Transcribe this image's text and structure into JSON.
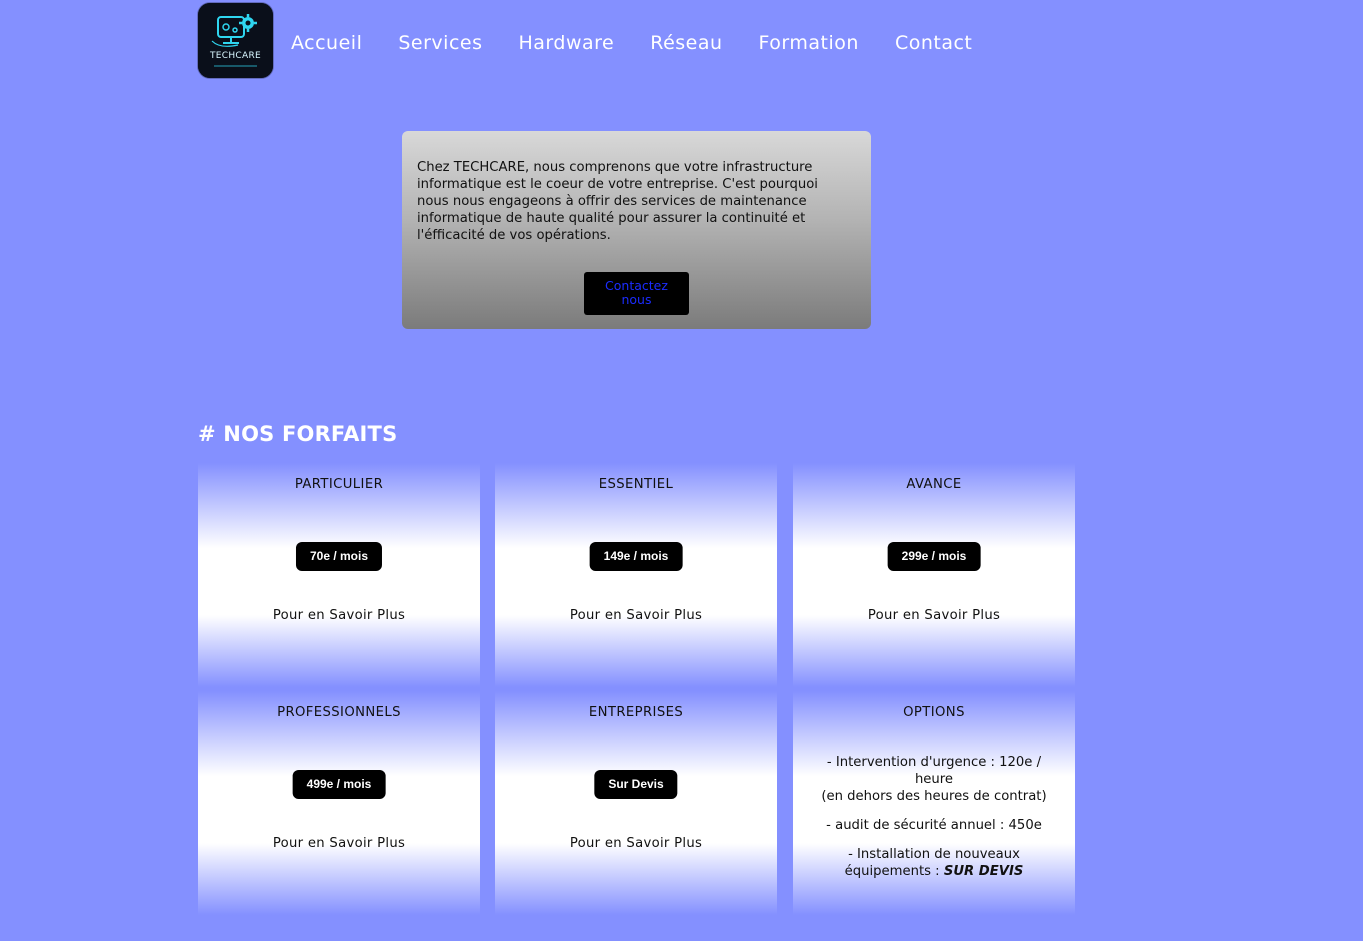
{
  "logo": {
    "text": "TECHCARE",
    "icon": "computer-gear-logo-icon"
  },
  "nav": [
    {
      "label": "Accueil"
    },
    {
      "label": "Services"
    },
    {
      "label": "Hardware"
    },
    {
      "label": "Réseau"
    },
    {
      "label": "Formation"
    },
    {
      "label": "Contact"
    }
  ],
  "hero": {
    "text": "Chez TECHCARE, nous comprenons que votre infrastructure informatique est le coeur de votre entreprise. C'est pourquoi nous nous engageons à offrir des services de maintenance informatique de haute qualité pour assurer la continuité et l'éfficacité de vos opérations.",
    "button_line1": "Contactez",
    "button_line2": "nous"
  },
  "section_title": "# NOS FORFAITS",
  "plans": [
    {
      "title": "PARTICULIER",
      "price": "70e / mois",
      "more": "Pour en Savoir Plus"
    },
    {
      "title": "ESSENTIEL",
      "price": "149e / mois",
      "more": "Pour en Savoir Plus"
    },
    {
      "title": "AVANCE",
      "price": "299e / mois",
      "more": "Pour en Savoir Plus"
    },
    {
      "title": "PROFESSIONNELS",
      "price": "499e / mois",
      "more": "Pour en Savoir Plus"
    },
    {
      "title": "ENTREPRISES",
      "price": "Sur Devis",
      "more": "Pour en Savoir Plus"
    }
  ],
  "options": {
    "title": "OPTIONS",
    "item1_line1": "- Intervention d'urgence : 120e / heure",
    "item1_line2": "(en dehors des heures de contrat)",
    "item2": "- audit de sécurité annuel : 450e",
    "item3_text": "- Installation de nouveaux équipements : ",
    "item3_emphasis": "SUR DEVIS"
  },
  "colors": {
    "background": "#8490ff",
    "button_text_blue": "#1b2cff",
    "logo_accent": "#2fd6f0"
  }
}
